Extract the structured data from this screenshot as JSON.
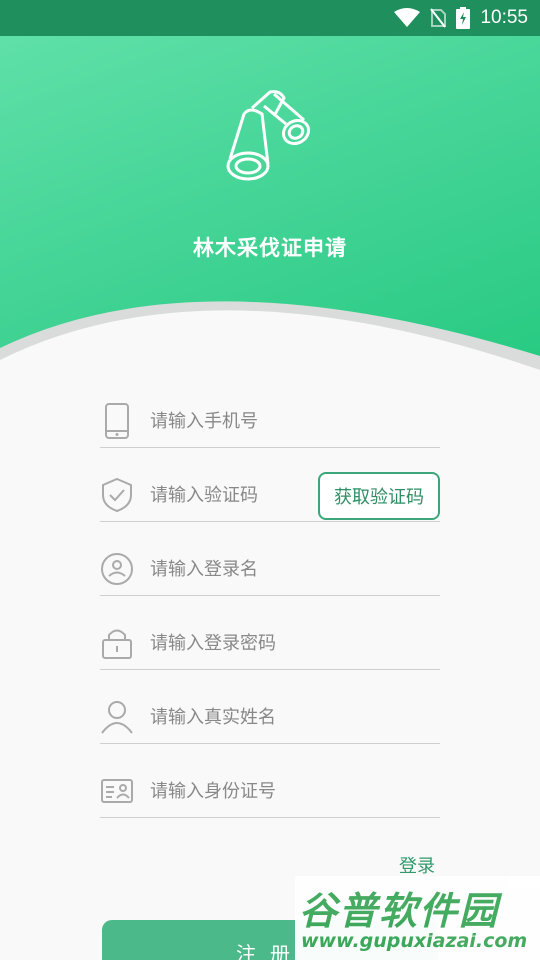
{
  "status_bar": {
    "time": "10:55"
  },
  "app": {
    "title": "林木采伐证申请"
  },
  "form": {
    "phone_placeholder": "请输入手机号",
    "code_placeholder": "请输入验证码",
    "get_code_label": "获取验证码",
    "username_placeholder": "请输入登录名",
    "password_placeholder": "请输入登录密码",
    "realname_placeholder": "请输入真实姓名",
    "idcard_placeholder": "请输入身份证号",
    "login_link": "登录",
    "register_label": "注册"
  },
  "watermark": {
    "brand": "谷普软件园",
    "url": "www.gupuxiazai.com"
  },
  "colors": {
    "accent": "#3fd293",
    "button": "#4cb98a",
    "status_bar": "#1f8f5e"
  }
}
